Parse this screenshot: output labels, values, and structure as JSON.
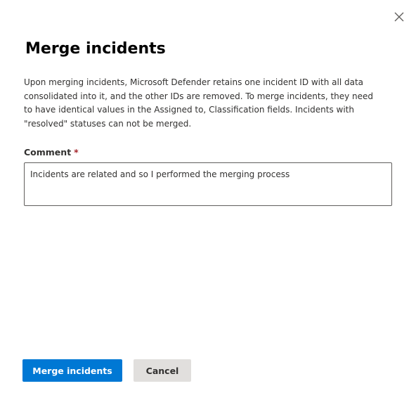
{
  "dialog": {
    "title": "Merge incidents",
    "description": "Upon merging incidents, Microsoft Defender retains one incident ID with all data consolidated into it, and the other IDs are removed. To merge incidents, they need to have identical values in the Assigned to, Classification fields. Incidents with \"resolved\" statuses can not be merged.",
    "close_icon": "close-icon"
  },
  "comment": {
    "label": "Comment",
    "required_marker": "*",
    "value": "Incidents are related and so I performed the merging process"
  },
  "actions": {
    "primary_label": "Merge incidents",
    "secondary_label": "Cancel"
  },
  "colors": {
    "primary": "#0078d4",
    "secondary": "#e1dfdd",
    "required": "#a4262c",
    "text": "#323130"
  }
}
